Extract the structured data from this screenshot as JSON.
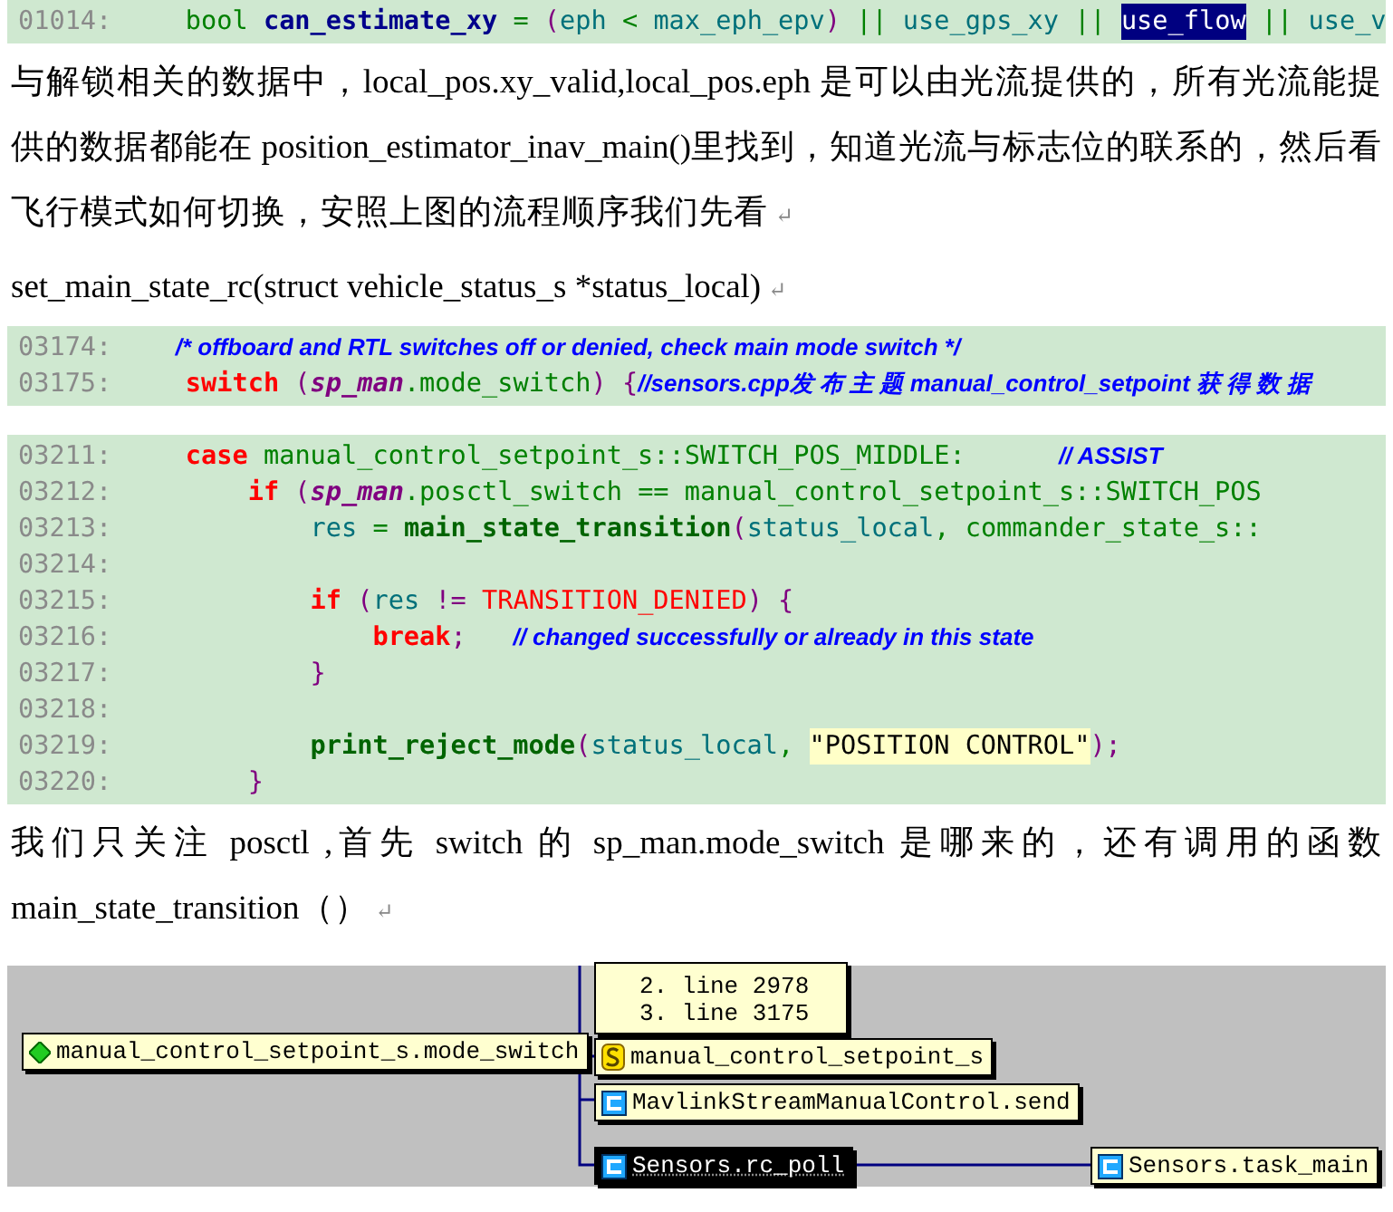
{
  "code_top": {
    "lines": [
      {
        "number": "01014:",
        "tokens": [
          {
            "t": "    bool ",
            "kind": "type"
          },
          {
            "t": "can_estimate_xy",
            "kind": "decl"
          },
          {
            "t": " = ",
            "kind": "op"
          },
          {
            "t": "(",
            "kind": "punct"
          },
          {
            "t": "eph",
            "kind": "ident"
          },
          {
            "t": " < ",
            "kind": "op"
          },
          {
            "t": "max_eph_epv",
            "kind": "ident"
          },
          {
            "t": ")",
            "kind": "punct"
          },
          {
            "t": " || ",
            "kind": "op"
          },
          {
            "t": "use_gps_xy",
            "kind": "ident"
          },
          {
            "t": " || ",
            "kind": "op"
          },
          {
            "t": "use_flow",
            "kind": "selected"
          },
          {
            "t": " || ",
            "kind": "op"
          },
          {
            "t": "use_v",
            "kind": "ident"
          }
        ]
      }
    ]
  },
  "paragraph_1": {
    "text": "与解锁相关的数据中，local_pos.xy_valid,local_pos.eph 是可以由光流提供的，所有光流能提供的数据都能在 position_estimator_inav_main()里找到，知道光流与标志位的联系的，然后看飞行模式如何切换，安照上图的流程顺序我们先看",
    "mark": "↵"
  },
  "paragraph_2": {
    "text": "set_main_state_rc(struct vehicle_status_s *status_local)",
    "mark": "↵"
  },
  "code_blocks": [
    {
      "lines": [
        {
          "number": "03174:",
          "tokens": [
            {
              "t": "        /* offboard and RTL switches off or denied, check main mode switch */",
              "kind": "comment"
            }
          ]
        },
        {
          "number": "03175:",
          "tokens": [
            {
              "t": "    switch",
              "kind": "keyword"
            },
            {
              "t": " (",
              "kind": "punct"
            },
            {
              "t": "sp_man",
              "kind": "var"
            },
            {
              "t": ".mode_switch",
              "kind": "type"
            },
            {
              "t": ") {",
              "kind": "punct"
            },
            {
              "t": "//sensors.cpp发 布 主 题 manual_control_setpoint 获 得 数 据",
              "kind": "comment"
            }
          ]
        }
      ]
    },
    {
      "lines": [
        {
          "number": "03211:",
          "tokens": [
            {
              "t": "    case",
              "kind": "keyword"
            },
            {
              "t": " manual_control_setpoint_s::SWITCH_POS_MIDDLE:      ",
              "kind": "type"
            },
            {
              "t": "// ASSIST",
              "kind": "comment"
            }
          ]
        },
        {
          "number": "03212:",
          "tokens": [
            {
              "t": "        if",
              "kind": "keyword"
            },
            {
              "t": " (",
              "kind": "punct"
            },
            {
              "t": "sp_man",
              "kind": "var"
            },
            {
              "t": ".posctl_switch == manual_control_setpoint_s::SWITCH_POS",
              "kind": "type"
            }
          ]
        },
        {
          "number": "03213:",
          "tokens": [
            {
              "t": "            res",
              "kind": "ident"
            },
            {
              "t": " = ",
              "kind": "type"
            },
            {
              "t": "main_state_transition",
              "kind": "func"
            },
            {
              "t": "(",
              "kind": "punct"
            },
            {
              "t": "status_local",
              "kind": "ident"
            },
            {
              "t": ", commander_state_s::",
              "kind": "type"
            }
          ]
        },
        {
          "number": "03214:"
        },
        {
          "number": "03215:",
          "tokens": [
            {
              "t": "            if",
              "kind": "keyword"
            },
            {
              "t": " (",
              "kind": "punct"
            },
            {
              "t": "res",
              "kind": "ident"
            },
            {
              "t": " != ",
              "kind": "punct"
            },
            {
              "t": "TRANSITION_DENIED",
              "kind": "const"
            },
            {
              "t": ") {",
              "kind": "punct"
            }
          ]
        },
        {
          "number": "03216:",
          "tokens": [
            {
              "t": "                break",
              "kind": "keyword"
            },
            {
              "t": ";   ",
              "kind": "punct"
            },
            {
              "t": "// changed successfully or already in this state",
              "kind": "comment"
            }
          ]
        },
        {
          "number": "03217:",
          "tokens": [
            {
              "t": "            }",
              "kind": "punct"
            }
          ]
        },
        {
          "number": "03218:"
        },
        {
          "number": "03219:",
          "tokens": [
            {
              "t": "            print_reject_mode",
              "kind": "func"
            },
            {
              "t": "(",
              "kind": "punct"
            },
            {
              "t": "status_local",
              "kind": "ident"
            },
            {
              "t": ", ",
              "kind": "type"
            },
            {
              "t": "\"POSITION CONTROL\"",
              "kind": "string"
            },
            {
              "t": ");",
              "kind": "punct"
            }
          ]
        },
        {
          "number": "03220:",
          "tokens": [
            {
              "t": "        }",
              "kind": "punct"
            }
          ]
        }
      ]
    }
  ],
  "paragraph_3": {
    "text": "我们只关注 posctl ,首先 switch 的 sp_man.mode_switch 是哪来的，还有调用的函数 main_state_transition（）",
    "mark": "↵"
  },
  "call_graph": {
    "nodes": [
      {
        "kind": "list",
        "label": "2. line 2978",
        "label_2": "3. line 3175"
      },
      {
        "kind": "field",
        "label": "manual_control_setpoint_s.mode_switch",
        "selected": false
      },
      {
        "kind": "struct",
        "label": "manual_control_setpoint_s",
        "selected": false
      },
      {
        "kind": "class",
        "label": "MavlinkStreamManualControl.send",
        "selected": false
      },
      {
        "kind": "class",
        "label": "Sensors.rc_poll",
        "selected": true
      },
      {
        "kind": "class",
        "label": "Sensors.task_main",
        "selected": false
      }
    ]
  }
}
